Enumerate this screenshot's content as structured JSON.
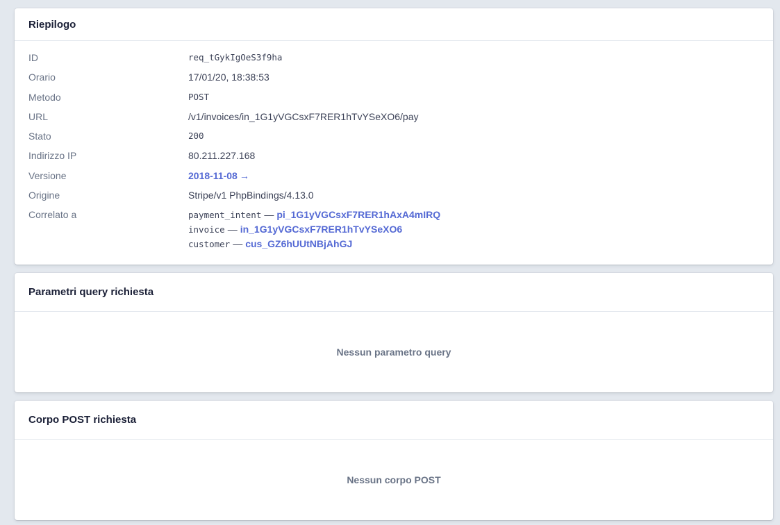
{
  "summary": {
    "title": "Riepilogo",
    "rows": [
      {
        "label": "ID",
        "value": "req_tGykIgOeS3f9ha"
      },
      {
        "label": "Orario",
        "value": "17/01/20, 18:38:53"
      },
      {
        "label": "Metodo",
        "value": "POST"
      },
      {
        "label": "URL",
        "value": "/v1/invoices/in_1G1yVGCsxF7RER1hTvYSeXO6/pay"
      },
      {
        "label": "Stato",
        "value": "200"
      },
      {
        "label": "Indirizzo IP",
        "value": "80.211.227.168"
      },
      {
        "label": "Versione",
        "value": "2018-11-08",
        "arrow": "→"
      },
      {
        "label": "Origine",
        "value": "Stripe/v1 PhpBindings/4.13.0"
      },
      {
        "label": "Correlato a"
      }
    ],
    "related": [
      {
        "key": "payment_intent",
        "sep": "—",
        "id": "pi_1G1yVGCsxF7RER1hAxA4mIRQ"
      },
      {
        "key": "invoice",
        "sep": "—",
        "id": "in_1G1yVGCsxF7RER1hTvYSeXO6"
      },
      {
        "key": "customer",
        "sep": "—",
        "id": "cus_GZ6hUUtNBjAhGJ"
      }
    ]
  },
  "query": {
    "title": "Parametri query richiesta",
    "empty": "Nessun parametro query"
  },
  "post_body": {
    "title": "Corpo POST richiesta",
    "empty": "Nessun corpo POST"
  },
  "colors": {
    "background": "#e3e8ee",
    "link": "#5469d4",
    "label": "#697386",
    "text": "#3c4257",
    "heading": "#1a1f36"
  }
}
